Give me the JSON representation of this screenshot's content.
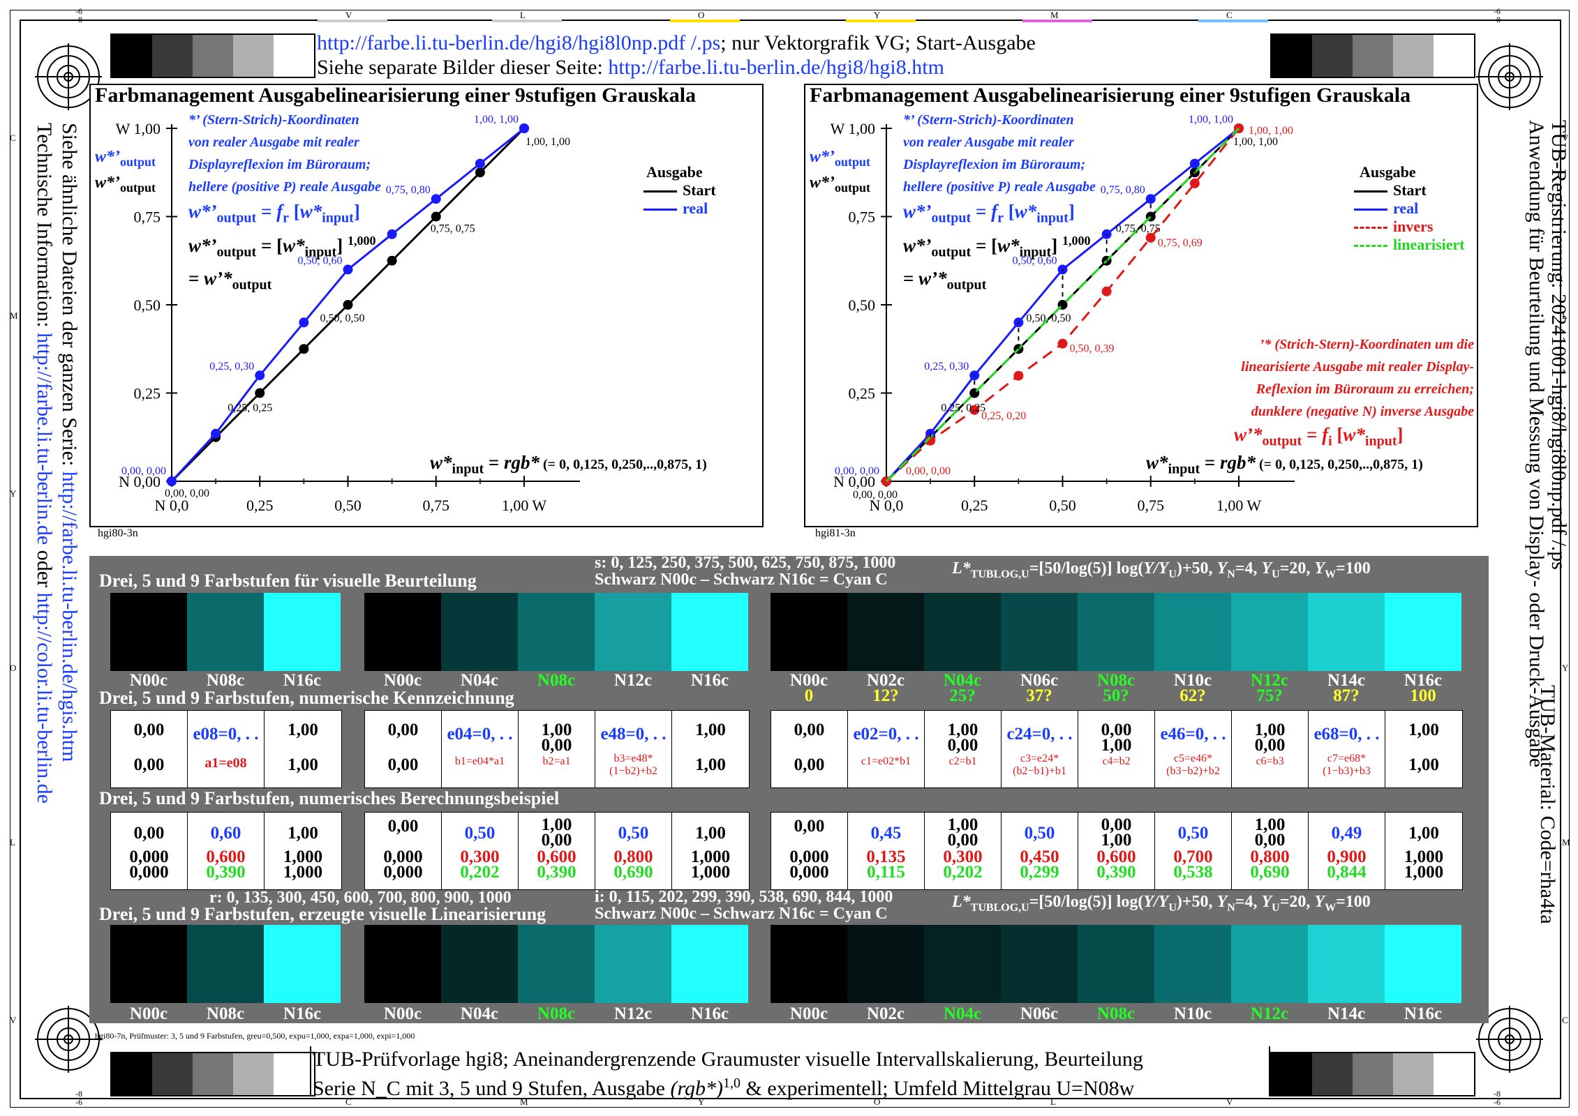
{
  "header": {
    "line1_url": "http://farbe.li.tu-berlin.de/hgi8/hgi8l0np.pdf /.ps",
    "line1_rest": "; nur Vektorgrafik VG; Start-Ausgabe",
    "line2_text": "Siehe separate Bilder dieser Seite: ",
    "line2_url": "http://farbe.li.tu-berlin.de/hgi8/hgi8.htm"
  },
  "footer": {
    "line1": "TUB-Prüfvorlage hgi8; Aneinandergrenzende Graumuster visuelle Intervallskalierung, Beurteilung",
    "line2_a": "Serie N_C mit 3, 5 und 9 Stufen, Ausgabe ",
    "line2_b": "(rgb*)",
    "line2_c": "1,0",
    "line2_d": " & experimentell; Umfeld Mittelgrau U=N08w",
    "smallnote": "hgi80-7n, Prüfmuster: 3, 5 und 9 Farbstufen, greu=0,500, expu=1,000, expa=1,000, expi=1,000"
  },
  "left_vertical": {
    "line1_a": "Siehe ähnliche Dateien der ganzen Serie: ",
    "line1_url": "http://farbe.li.tu-berlin.de/hgis.htm",
    "line2_a": "Technische Information: ",
    "line2_url1": "http://farbe.li.tu-berlin.de",
    "line2_b": " oder ",
    "line2_url2": "http://color.li.tu-berlin.de"
  },
  "right_vertical": {
    "line1": "TUB-Registrierung: 20241001-hgi8/hgi8l0np.pdf /.ps",
    "line2": "Anwendung für Beurteilung und Messung von Display- oder Druck-Ausgabe",
    "line3": "TUB-Material: Code=rha4ta"
  },
  "edge_letters": {
    "top": [
      "V",
      "L",
      "O",
      "Y",
      "M",
      "C"
    ],
    "top_corner_left": [
      "-6",
      "-8"
    ],
    "top_corner_right": [
      "-6",
      "-8"
    ],
    "bottom": [
      "C",
      "M",
      "Y",
      "O",
      "L",
      "V"
    ],
    "bottom_corner_left": [
      "-8",
      "-6"
    ],
    "bottom_corner_right": [
      "-8",
      "-6"
    ],
    "left": [
      "C",
      "M",
      "Y",
      "O",
      "L",
      "V"
    ],
    "right": [
      "V",
      "L",
      "Y",
      "M",
      "C"
    ]
  },
  "plot_left": {
    "title": "Farbmanagement Ausgabelinearisierung einer 9stufigen Grauskala",
    "id": "hgi80-3n",
    "note_blue": [
      "*’ (Stern-Strich)-Koordinaten",
      "von realer Ausgabe mit realer",
      "Displayreflexion im Büroraum;",
      "hellere (positive P) reale Ausgabe"
    ],
    "ylab_blue": "w*’",
    "ylab_blue_sub": "output",
    "ylab_black": "w*’",
    "ylab_black_sub": "output",
    "eq1_a": "w*’",
    "eq1_sub": "output",
    "eq1_b": " = ",
    "eq1_f": "f",
    "eq1_fsub": "r",
    "eq1_c": " [",
    "eq1_d": "w*",
    "eq1_dsub": "input",
    "eq1_e": "]",
    "eq2_a": "w*’",
    "eq2_sub": "output",
    "eq2_b": " = [",
    "eq2_c": "w*",
    "eq2_csub": "input",
    "eq2_d": "] ",
    "eq2_exp": "1,000",
    "eq3_a": "= ",
    "eq3_b": "w’*",
    "eq3_sub": "output",
    "xinput_a": "w*",
    "xinput_sub": "input",
    "xinput_b": " = ",
    "xinput_c": "rgb*",
    "xinput_d": " (= 0, 0,125, 0,250,..,0,875, 1)",
    "legend_title": "Ausgabe",
    "legend": [
      {
        "name": "Start",
        "color": "#000000"
      },
      {
        "name": "real",
        "color": "#1a1aff"
      }
    ]
  },
  "plot_right": {
    "title": "Farbmanagement Ausgabelinearisierung einer 9stufigen Grauskala",
    "id": "hgi81-3n",
    "note_red": [
      "’* (Strich-Stern)-Koordinaten um die",
      "linearisierte Ausgabe mit realer Display-",
      "Reflexion im Büroraum zu erreichen;",
      "dunklere (negative N) inverse Ausgabe"
    ],
    "eq_red_a": "w’*",
    "eq_red_sub": "output",
    "eq_red_b": " = ",
    "eq_red_f": "f",
    "eq_red_fsub": "i",
    "eq_red_c": " [",
    "eq_red_d": "w*",
    "eq_red_dsub": "input",
    "eq_red_e": "]",
    "legend_title": "Ausgabe",
    "legend": [
      {
        "name": "Start",
        "color": "#000000"
      },
      {
        "name": "real",
        "color": "#1a1aff"
      },
      {
        "name": "invers",
        "color": "#e01818"
      },
      {
        "name": "linearisiert",
        "color": "#22dd22"
      }
    ]
  },
  "chart_data": [
    {
      "type": "line",
      "title": "Farbmanagement Ausgabelinearisierung einer 9stufigen Grauskala",
      "xlabel": "w*input = rgb* (= 0, 0,125, 0,250,..,0,875, 1)",
      "ylabel": "w*’output",
      "xlim": [
        0,
        1
      ],
      "ylim": [
        0,
        1
      ],
      "xticks": [
        "N  0,0",
        "0,25",
        "0,50",
        "0,75",
        "1,00  W"
      ],
      "yticks": [
        "N 0,00",
        "0,25",
        "0,50",
        "0,75",
        "W 1,00"
      ],
      "x": [
        0,
        0.125,
        0.25,
        0.375,
        0.5,
        0.625,
        0.75,
        0.875,
        1.0
      ],
      "series": [
        {
          "name": "Start",
          "color": "#000000",
          "values": [
            0,
            0.125,
            0.25,
            0.375,
            0.5,
            0.625,
            0.75,
            0.875,
            1.0
          ]
        },
        {
          "name": "real",
          "color": "#1a1aff",
          "values": [
            0,
            0.135,
            0.3,
            0.45,
            0.6,
            0.7,
            0.8,
            0.9,
            1.0
          ]
        }
      ],
      "annotations": [
        {
          "text": "0,00, 0,00",
          "color": "#1a1aff"
        },
        {
          "text": "0,00, 0,00",
          "color": "#000000"
        },
        {
          "text": "0,25, 0,30",
          "color": "#1a1aff"
        },
        {
          "text": "0,25, 0,25",
          "color": "#000000"
        },
        {
          "text": "0,50, 0,60",
          "color": "#1a1aff"
        },
        {
          "text": "0,50, 0,50",
          "color": "#000000"
        },
        {
          "text": "0,75, 0,80",
          "color": "#1a1aff"
        },
        {
          "text": "0,75, 0,75",
          "color": "#000000"
        },
        {
          "text": "1,00, 1,00",
          "color": "#1a1aff"
        },
        {
          "text": "1,00, 1,00",
          "color": "#000000"
        }
      ]
    },
    {
      "type": "line",
      "title": "Farbmanagement Ausgabelinearisierung einer 9stufigen Grauskala",
      "xlabel": "w*input = rgb* (= 0, 0,125, 0,250,..,0,875, 1)",
      "ylabel": "w*’output",
      "xlim": [
        0,
        1
      ],
      "ylim": [
        0,
        1
      ],
      "xticks": [
        "N  0,0",
        "0,25",
        "0,50",
        "0,75",
        "1,00  W"
      ],
      "yticks": [
        "N 0,00",
        "0,25",
        "0,50",
        "0,75",
        "W 1,00"
      ],
      "x": [
        0,
        0.125,
        0.25,
        0.375,
        0.5,
        0.625,
        0.75,
        0.875,
        1.0
      ],
      "series": [
        {
          "name": "Start",
          "color": "#000000",
          "values": [
            0,
            0.125,
            0.25,
            0.375,
            0.5,
            0.625,
            0.75,
            0.875,
            1.0
          ]
        },
        {
          "name": "real",
          "color": "#1a1aff",
          "values": [
            0,
            0.135,
            0.3,
            0.45,
            0.6,
            0.7,
            0.8,
            0.9,
            1.0
          ]
        },
        {
          "name": "invers",
          "color": "#e01818",
          "values": [
            0,
            0.115,
            0.202,
            0.299,
            0.39,
            0.538,
            0.69,
            0.844,
            1.0
          ]
        },
        {
          "name": "linearisiert",
          "color": "#22dd22",
          "values": [
            0,
            0.125,
            0.25,
            0.375,
            0.5,
            0.625,
            0.75,
            0.875,
            1.0
          ]
        }
      ],
      "annotations": [
        {
          "text": "0,00, 0,00",
          "color": "#1a1aff"
        },
        {
          "text": "0,00, 0,00",
          "color": "#e01818"
        },
        {
          "text": "0,00, 0,00",
          "color": "#000000"
        },
        {
          "text": "0,25, 0,30",
          "color": "#1a1aff"
        },
        {
          "text": "0,25, 0,25",
          "color": "#000000"
        },
        {
          "text": "0,25, 0,20",
          "color": "#e01818"
        },
        {
          "text": "0,50, 0,60",
          "color": "#1a1aff"
        },
        {
          "text": "0,50, 0,50",
          "color": "#000000"
        },
        {
          "text": "0,50, 0,39",
          "color": "#e01818"
        },
        {
          "text": "0,75, 0,80",
          "color": "#1a1aff"
        },
        {
          "text": "0,75, 0,75",
          "color": "#000000"
        },
        {
          "text": "0,75, 0,69",
          "color": "#e01818"
        },
        {
          "text": "1,00, 1,00",
          "color": "#1a1aff"
        },
        {
          "text": "1,00, 1,00",
          "color": "#e01818"
        },
        {
          "text": "1,00, 1,00",
          "color": "#000000"
        }
      ]
    }
  ],
  "table": {
    "s_line": "s: 0, 125, 250, 375, 500, 625, 750, 875, 1000",
    "schwarz_line": "Schwarz N00c – Schwarz N16c = Cyan C",
    "lstar_a": "L*",
    "lstar_sub": "TUBLOG,U",
    "lstar_b": "=[50/log(5)] log(",
    "lstar_c": "Y/Y",
    "lstar_csub": "U",
    "lstar_d": ")+50, ",
    "lstar_e": "Y",
    "lstar_esub": "N",
    "lstar_f": "=4, ",
    "lstar_g": "Y",
    "lstar_gsub": "U",
    "lstar_h": "=20, ",
    "lstar_i": "Y",
    "lstar_isub": "W",
    "lstar_j": "=100",
    "head1": "Drei, 5 und 9 Farbstufen für visuelle Beurteilung",
    "head2": "Drei, 5 und 9 Farbstufen, numerische Kennzeichnung",
    "head3": "Drei, 5 und 9 Farbstufen, numerisches Berechnungsbeispiel",
    "head4": "Drei, 5 und 9 Farbstufen, erzeugte visuelle Linearisierung",
    "r_line": "r: 0, 135, 300, 450, 600, 700, 800, 900, 1000",
    "i_line": "i: 0, 115, 202, 299, 390, 538, 690, 844, 1000",
    "schwarz_line2": "Schwarz N00c – Schwarz N16c = Cyan C",
    "swatches_top": {
      "g3": [
        "#000000",
        "#0b6a6a",
        "#22ffff"
      ],
      "g5": [
        "#000000",
        "#053838",
        "#0b6a6a",
        "#179f9f",
        "#22ffff"
      ],
      "g9": [
        "#000000",
        "#041818",
        "#053030",
        "#074848",
        "#0b6a6a",
        "#0f8a8a",
        "#15aaaa",
        "#1cd0d0",
        "#22ffff"
      ]
    },
    "swatches_bottom": {
      "g3": [
        "#000000",
        "#064a4a",
        "#22ffff"
      ],
      "g5": [
        "#000000",
        "#042828",
        "#0b6a6a",
        "#15a2a2",
        "#22ffff"
      ],
      "g9": [
        "#000000",
        "#031212",
        "#042222",
        "#052e2e",
        "#064a4a",
        "#0a6c6c",
        "#13a2a2",
        "#1cd2d2",
        "#22ffff"
      ]
    },
    "labels3": [
      "N00c",
      "N08c",
      "N16c"
    ],
    "labels5": [
      "N00c",
      "N04c",
      "N08c",
      "N12c",
      "N16c"
    ],
    "labels9": [
      "N00c",
      "N02c",
      "N04c",
      "N06c",
      "N08c",
      "N10c",
      "N12c",
      "N14c",
      "N16c"
    ],
    "labels9_nums": [
      "0",
      "12?",
      "25?",
      "37?",
      "50?",
      "62?",
      "75?",
      "87?",
      "100"
    ],
    "code3": [
      {
        "top": "0,00",
        "bot": "0,00",
        "color": "#000"
      },
      {
        "top": "e08=0, . .",
        "bot": "a1=e08",
        "color": "blue"
      },
      {
        "top": "1,00",
        "bot": "1,00",
        "color": "#000"
      }
    ],
    "code5": [
      {
        "top": "0,00",
        "bot": "0,00"
      },
      {
        "top": "e04=0, . .",
        "bot": "b1=e04*a1"
      },
      {
        "top": "1,00",
        "mid": "0,00",
        "bot": "b2=a1"
      },
      {
        "top": "e48=0, . .",
        "bot": "b3=e48*",
        "bot2": "(1−b2)+b2"
      },
      {
        "top": "1,00",
        "bot": "1,00"
      }
    ],
    "code9": [
      {
        "top": "0,00",
        "bot": "0,00"
      },
      {
        "top": "e02=0, . .",
        "bot": "c1=e02*b1"
      },
      {
        "top": "1,00",
        "mid": "0,00",
        "bot": "c2=b1"
      },
      {
        "top": "c24=0, . .",
        "bot": "c3=e24*",
        "bot2": "(b2−b1)+b1"
      },
      {
        "top": "0,00",
        "mid": "1,00",
        "bot": "c4=b2"
      },
      {
        "top": "e46=0, . .",
        "bot": "c5=e46*",
        "bot2": "(b3−b2)+b2"
      },
      {
        "top": "1,00",
        "mid": "0,00",
        "bot": "c6=b3"
      },
      {
        "top": "e68=0, . .",
        "bot": "c7=e68*",
        "bot2": "(1−b3)+b3"
      },
      {
        "top": "1,00",
        "bot": "1,00"
      }
    ],
    "calc3": [
      {
        "a": "0,00",
        "b": "0,000",
        "c": "0,000"
      },
      {
        "a": "0,60",
        "b": "0,600",
        "c": "0,390"
      },
      {
        "a": "1,00",
        "b": "1,000",
        "c": "1,000"
      }
    ],
    "calc5": [
      {
        "a": "0,00",
        "b": "0,000",
        "c": "0,000"
      },
      {
        "a": "0,50",
        "b": "0,300",
        "c": "0,202"
      },
      {
        "a": "1,00",
        "a2": "0,00",
        "b": "0,600",
        "c": "0,390"
      },
      {
        "a": "0,50",
        "b": "0,800",
        "c": "0,690"
      },
      {
        "a": "1,00",
        "b": "1,000",
        "c": "1,000"
      }
    ],
    "calc9": [
      {
        "a": "0,00",
        "b": "0,000",
        "c": "0,000"
      },
      {
        "a": "0,45",
        "b": "0,135",
        "c": "0,115"
      },
      {
        "a": "1,00",
        "a2": "0,00",
        "b": "0,300",
        "c": "0,202"
      },
      {
        "a": "0,50",
        "b": "0,450",
        "c": "0,299"
      },
      {
        "a": "0,00",
        "a2": "1,00",
        "b": "0,600",
        "c": "0,390"
      },
      {
        "a": "0,50",
        "b": "0,700",
        "c": "0,538"
      },
      {
        "a": "1,00",
        "a2": "0,00",
        "b": "0,800",
        "c": "0,690"
      },
      {
        "a": "0,49",
        "b": "0,900",
        "c": "0,844"
      },
      {
        "a": "1,00",
        "b": "1,000",
        "c": "1,000"
      }
    ]
  }
}
